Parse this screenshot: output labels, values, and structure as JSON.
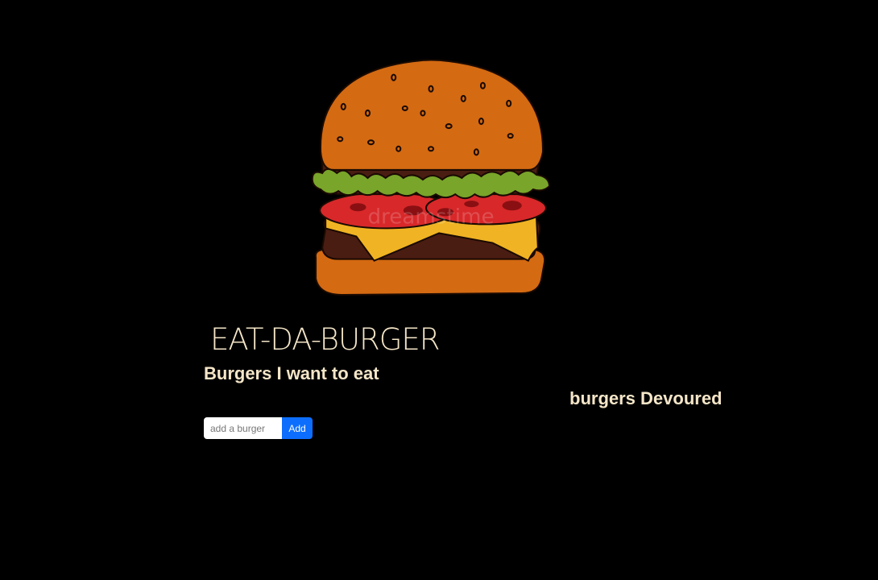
{
  "colors": {
    "background": "#000000",
    "heading_text": "#f5e6c8",
    "button_bg": "#0d6efd",
    "button_text": "#ffffff"
  },
  "hero": {
    "image": "burger-illustration",
    "watermark": "dreamstime"
  },
  "header": {
    "title": "EAT-DA-BURGER"
  },
  "lists": {
    "want_heading": "Burgers I want to eat",
    "devoured_heading": "burgers Devoured"
  },
  "form": {
    "input_placeholder": "add a burger",
    "input_value": "",
    "add_label": "Add"
  }
}
